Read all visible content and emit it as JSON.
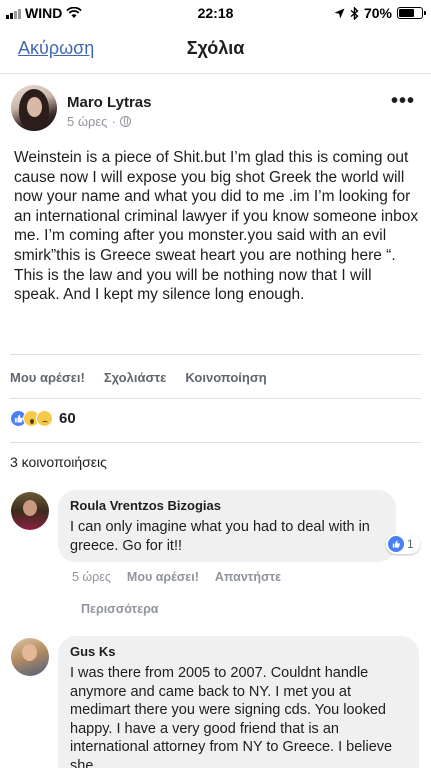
{
  "status_bar": {
    "carrier": "WIND",
    "time": "22:18",
    "battery": "70%",
    "battery_level": 0.7
  },
  "nav": {
    "cancel_label": "Ακύρωση",
    "title": "Σχόλια"
  },
  "post": {
    "author": "Maro Lytras",
    "time": "5 ώρες",
    "body": "Weinstein is a piece of Shit.but I’m glad this is coming out cause now I will expose you big shot Greek the world will now your name and what you did to me .im I’m looking for an international criminal lawyer if you know someone inbox me. I’m coming after you monster.you said with an evil smirk”this is Greece sweat heart you are nothing here “. This is the law and you will be nothing now that I will speak. And I kept my silence long enough."
  },
  "actions": {
    "like": "Μου αρέσει!",
    "comment": "Σχολιάστε",
    "share": "Κοινοποίηση"
  },
  "reactions": {
    "count": "60",
    "types": [
      "like",
      "wow",
      "sad"
    ]
  },
  "shares_text": "3 κοινοποιήσεις",
  "comments": [
    {
      "name": "Roula Vrentzos Bizogias",
      "text": "I can only imagine what you had to deal with in greece. Go for it!!",
      "likes": "1",
      "time": "5 ώρες",
      "like_label": "Μου αρέσει!",
      "reply_label": "Απαντήστε"
    },
    {
      "name": "Gus Ks",
      "text": "I was there from 2005 to 2007. Couldnt handle anymore and came back to NY. I met you at medimart there you were signing cds. You looked happy. I have a very good friend that is an international attorney from NY to Greece. I believe she"
    }
  ],
  "more_replies_label": "Περισσότερα",
  "icons": {
    "wifi": "wifi-icon",
    "location": "location-arrow-icon",
    "bluetooth": "bluetooth-icon",
    "globe": "globe-icon",
    "more": "more-options-icon"
  },
  "colors": {
    "link_blue": "#4267b2",
    "like_blue": "#4a80f5",
    "meta_gray": "#90949c",
    "bubble_bg": "#f1f0f0"
  }
}
